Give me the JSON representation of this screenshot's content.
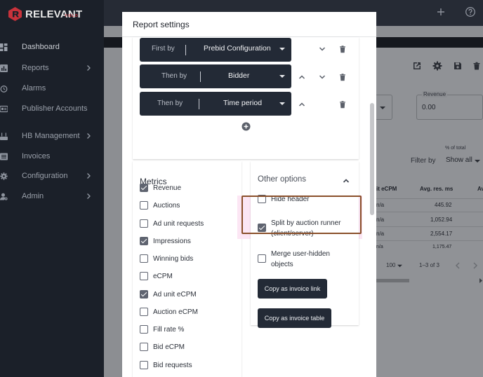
{
  "brand": {
    "name": "RELEVANT",
    "sub": "YIELD",
    "color": "#c8323b"
  },
  "sidebar": {
    "items": [
      {
        "label": "Dashboard",
        "icon": "dashboard-icon",
        "chevron": false,
        "active": true
      },
      {
        "label": "Reports",
        "icon": "bar-chart-icon",
        "chevron": true
      },
      {
        "label": "Alarms",
        "icon": "alarm-clock-icon",
        "chevron": false
      },
      {
        "label": "Publisher Accounts",
        "icon": "account-card-icon",
        "chevron": false
      },
      {
        "label": "HB Management",
        "icon": "router-icon",
        "chevron": true
      },
      {
        "label": "Invoices",
        "icon": "list-icon",
        "chevron": false
      },
      {
        "label": "Configuration",
        "icon": "gear-icon",
        "chevron": true
      },
      {
        "label": "Admin",
        "icon": "admin-icon",
        "chevron": true
      }
    ]
  },
  "topbar": {
    "icons": [
      "plus-icon",
      "help-icon"
    ]
  },
  "background": {
    "revenue_label": "Revenue",
    "revenue_value": "0.00",
    "filter_label": "Filter by",
    "pct_label": "% of total",
    "show_all": "Show all",
    "col_ecpm": "it eCPM",
    "col_avg": "Avg. res. ms",
    "col_more": "Av",
    "rows": [
      {
        "ecpm": "n/a",
        "avg": "445.92"
      },
      {
        "ecpm": "n/a",
        "avg": "1,052.94"
      },
      {
        "ecpm": "n/a",
        "avg": "2,554.17"
      },
      {
        "ecpm": "n/a",
        "avg": "1,175.47"
      }
    ],
    "per_page": "100",
    "range": "1–3 of 3"
  },
  "modal": {
    "title": "Report settings",
    "sort_rows": [
      {
        "prefix": "First by",
        "value": "Prebid Configuration"
      },
      {
        "prefix": "Then by",
        "value": "Bidder"
      },
      {
        "prefix": "Then by",
        "value": "Time period"
      }
    ],
    "metrics": {
      "title": "Metrics",
      "items": [
        {
          "label": "Revenue",
          "checked": true
        },
        {
          "label": "Auctions",
          "checked": false
        },
        {
          "label": "Ad unit requests",
          "checked": false
        },
        {
          "label": "Impressions",
          "checked": true
        },
        {
          "label": "Winning bids",
          "checked": false
        },
        {
          "label": "eCPM",
          "checked": false
        },
        {
          "label": "Ad unit eCPM",
          "checked": true
        },
        {
          "label": "Auction eCPM",
          "checked": false
        },
        {
          "label": "Fill rate %",
          "checked": false
        },
        {
          "label": "Bid eCPM",
          "checked": false
        },
        {
          "label": "Bid requests",
          "checked": false
        }
      ]
    },
    "other": {
      "title": "Other options",
      "items": [
        {
          "label": "Hide header",
          "checked": false
        },
        {
          "label": "Split by auction runner (client/server)",
          "checked": true,
          "highlighted": true
        },
        {
          "label": "Merge user-hidden objects",
          "checked": false
        }
      ],
      "copy_link": "Copy as invoice link",
      "copy_table": "Copy as invoice table"
    }
  }
}
